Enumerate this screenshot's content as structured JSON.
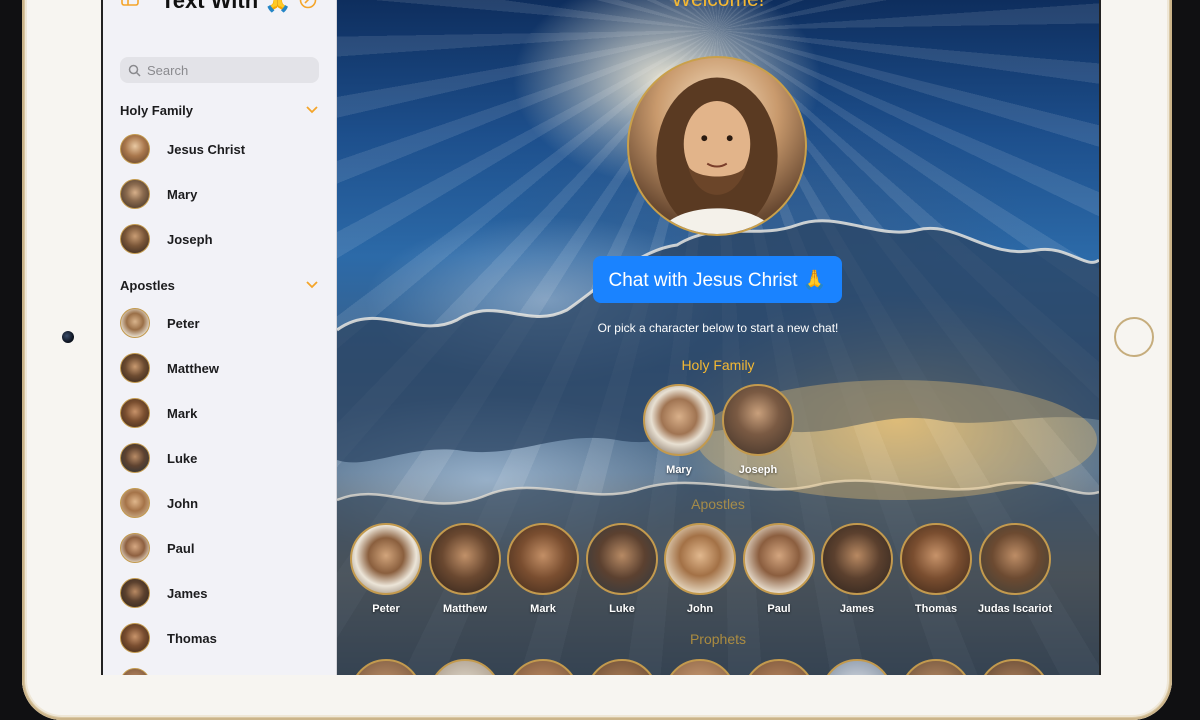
{
  "app": {
    "title": "Text With 🙏"
  },
  "sidebar": {
    "search_placeholder": "Search",
    "sections": [
      {
        "label": "Holy Family",
        "items": [
          "Jesus Christ",
          "Mary",
          "Joseph"
        ]
      },
      {
        "label": "Apostles",
        "items": [
          "Peter",
          "Matthew",
          "Mark",
          "Luke",
          "John",
          "Paul",
          "James",
          "Thomas"
        ]
      }
    ]
  },
  "main": {
    "welcome": "Welcome!",
    "chat_button": "Chat with Jesus Christ 🙏",
    "hint": "Or pick a character below to start a new chat!",
    "groups": [
      {
        "label": "Holy Family",
        "characters": [
          "Mary",
          "Joseph"
        ]
      },
      {
        "label": "Apostles",
        "characters": [
          "Peter",
          "Matthew",
          "Mark",
          "Luke",
          "John",
          "Paul",
          "James",
          "Thomas",
          "Judas Iscariot"
        ]
      },
      {
        "label": "Prophets",
        "characters": []
      }
    ]
  },
  "colors": {
    "accent_gold": "#f4b832",
    "button_blue": "#1a83ff",
    "avatar_ring": "#c39a4e",
    "sidebar_bg": "#f2f2f7"
  },
  "icons": {
    "sidebar_toggle": "sidebar-toggle-icon",
    "compose": "compose-icon",
    "search": "search-icon",
    "section_chevron": "chevron-down-icon"
  }
}
